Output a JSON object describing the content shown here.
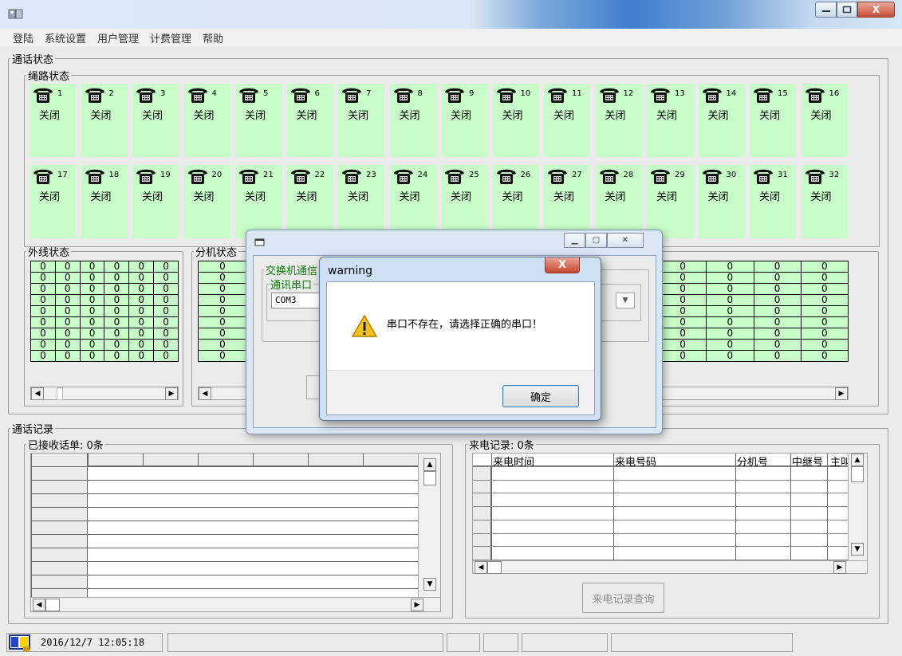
{
  "window": {
    "close_glyph": "X"
  },
  "menu": [
    "登陆",
    "系统设置",
    "用户管理",
    "计费管理",
    "帮助"
  ],
  "call_status": {
    "title": "通话状态",
    "lines_title": "绳路状态",
    "line_state": "关闭",
    "lines": [
      1,
      2,
      3,
      4,
      5,
      6,
      7,
      8,
      9,
      10,
      11,
      12,
      13,
      14,
      15,
      16,
      17,
      18,
      19,
      20,
      21,
      22,
      23,
      24,
      25,
      26,
      27,
      28,
      29,
      30,
      31,
      32
    ],
    "outer_title": "外线状态",
    "ext_title": "分机状态",
    "cell_value": "0"
  },
  "call_records": {
    "title": "通话记录",
    "received": "已接收话单: 0条",
    "incoming": "来电记录: 0条",
    "incoming_cols": [
      "来电时间",
      "来电号码",
      "分机号",
      "中继号",
      "主叫"
    ],
    "query_button": "来电记录查询"
  },
  "status": {
    "datetime": "2016/12/7 12:05:18",
    "badge_text": "1 2"
  },
  "back_dialog": {
    "group_label": "交换机通信",
    "port_label": "通讯串口",
    "port_value": "COM3"
  },
  "warning": {
    "title": "warning",
    "message": "串口不存在，请选择正确的串口！",
    "ok": "确定",
    "close_glyph": "X"
  },
  "colors": {
    "tile_green": "#c8fcc8",
    "title_accent": "#3f7fcf"
  }
}
